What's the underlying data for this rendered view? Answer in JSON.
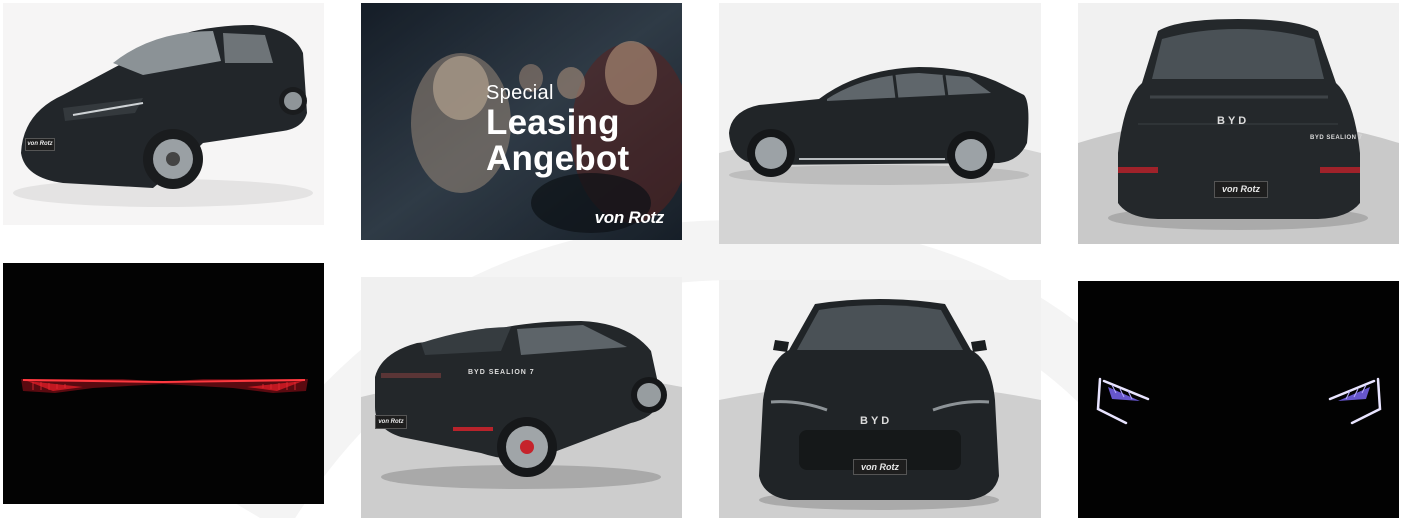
{
  "gallery": {
    "images": [
      {
        "id": "car-front-three-quarter",
        "alt_subject": "BYD Sealion 7 front three-quarter view"
      },
      {
        "id": "leasing-promo",
        "alt_subject": "Special Leasing Angebot promo"
      },
      {
        "id": "car-side-profile",
        "alt_subject": "BYD Sealion 7 side profile"
      },
      {
        "id": "car-rear",
        "alt_subject": "BYD Sealion 7 rear view"
      },
      {
        "id": "car-taillight-dark",
        "alt_subject": "Taillight light bar in the dark"
      },
      {
        "id": "car-rear-three-quarter",
        "alt_subject": "BYD Sealion 7 rear three-quarter view"
      },
      {
        "id": "car-front",
        "alt_subject": "BYD Sealion 7 front view"
      },
      {
        "id": "car-headlights-dark",
        "alt_subject": "Headlights in the dark"
      }
    ]
  },
  "promo": {
    "line1": "Special",
    "line2a": "Leasing",
    "line2b": "Angebot",
    "brand": "von Rotz"
  },
  "vehicle": {
    "brand_badge": "BYD",
    "model_badge": "BYD SEALION 7",
    "dealer_plate": "von Rotz"
  },
  "colors": {
    "car_body": "#1f2326",
    "taillight": "#e0202a",
    "headlight": "#dcd7ff"
  }
}
